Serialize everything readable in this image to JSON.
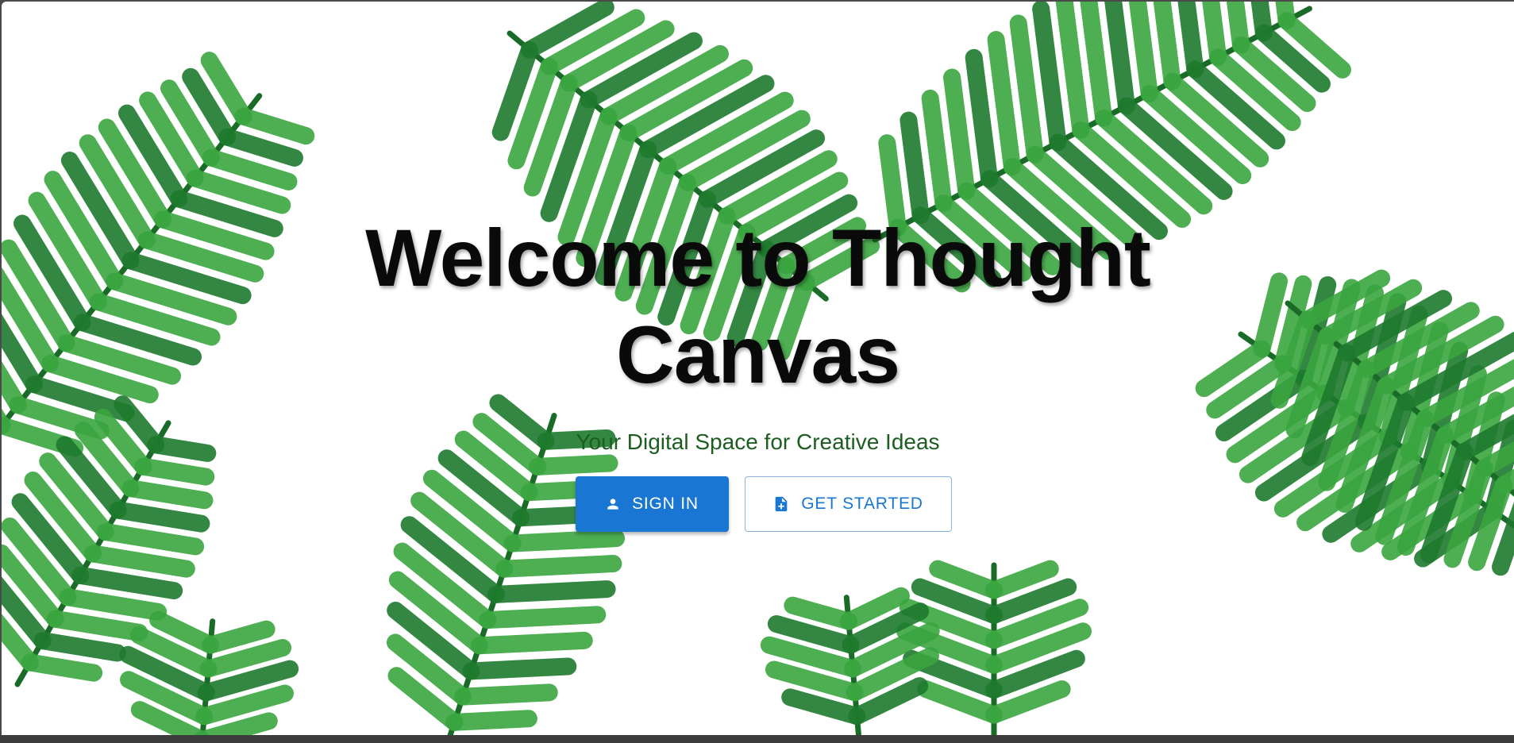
{
  "hero": {
    "title": "Welcome to Thought Canvas",
    "subtitle": "Your Digital Space for Creative Ideas"
  },
  "actions": {
    "sign_in": {
      "label": "SIGN IN",
      "icon": "person-icon"
    },
    "get_started": {
      "label": "GET STARTED",
      "icon": "note-add-icon"
    }
  },
  "colors": {
    "primary": "#1976d2",
    "subtitle": "#1b5e20",
    "leaf_dark": "#1e7a2e",
    "leaf_light": "#3aa53f"
  }
}
